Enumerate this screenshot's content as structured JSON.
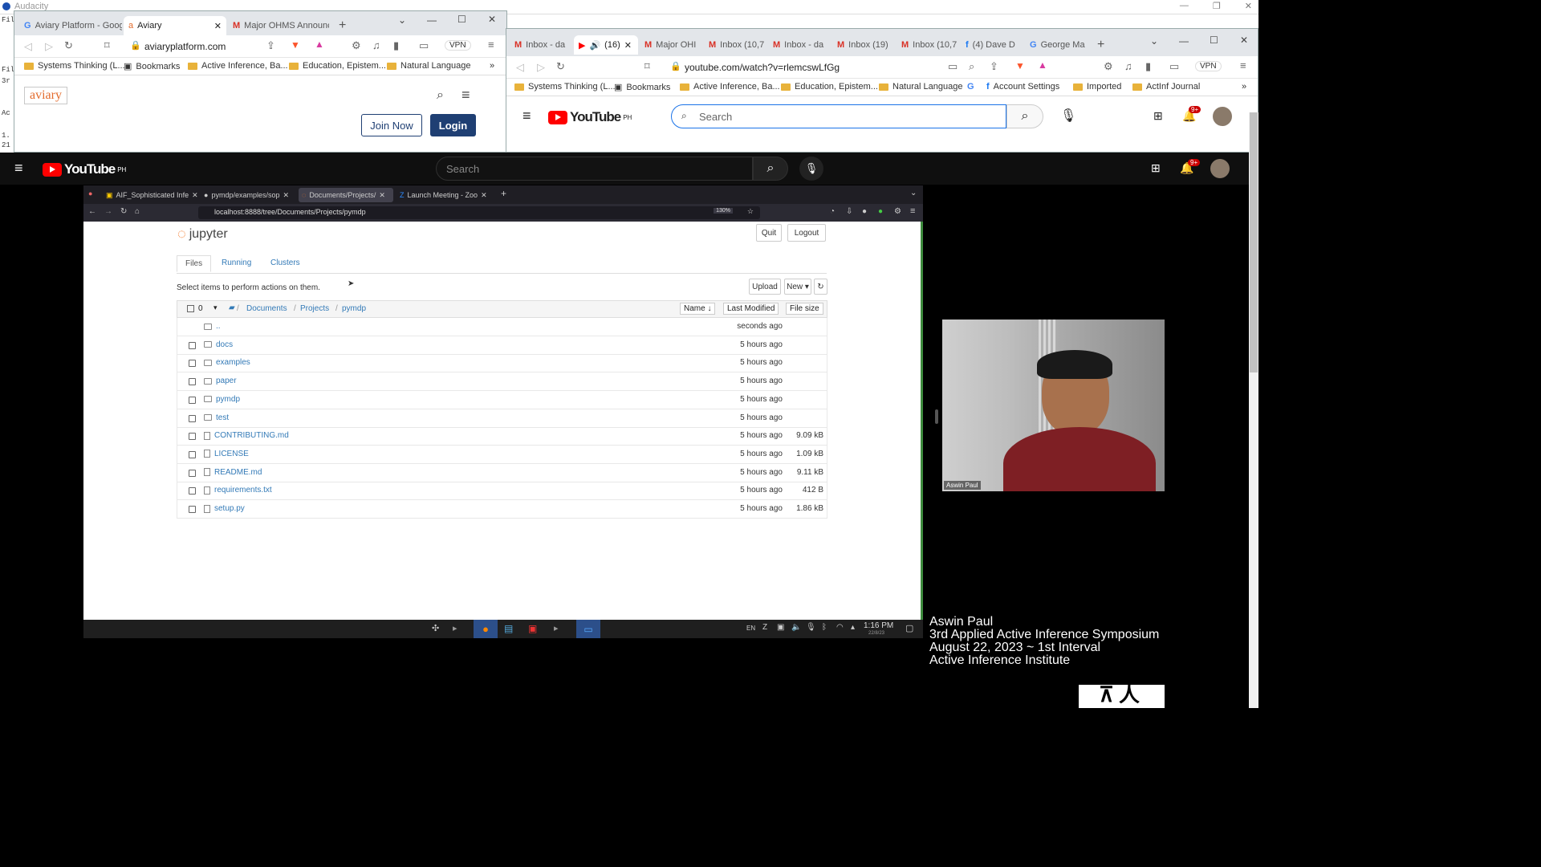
{
  "audacity": {
    "title": "Audacity"
  },
  "left_strip": [
    "Fil",
    "3r",
    "Ac",
    "Fil",
    "1.",
    "21"
  ],
  "aviary_window": {
    "tabs": [
      {
        "label": "Aviary Platform - Goog"
      },
      {
        "label": "Aviary",
        "active": true
      },
      {
        "label": "Major OHMS Announc"
      }
    ],
    "url": "aviaryplatform.com",
    "vpn": "VPN",
    "bookmarks": [
      "Systems Thinking (L...",
      "Bookmarks",
      "Active Inference, Ba...",
      "Education, Epistem...",
      "Natural Language"
    ],
    "logo": "aviary",
    "join_label": "Join Now",
    "login_label": "Login"
  },
  "youtube_window": {
    "tabs": [
      "Inbox - da",
      "(16)",
      "Major OHI",
      "Inbox (10,7",
      "Inbox - da",
      "Inbox (19)",
      "Inbox (10,7",
      "(4) Dave D",
      "George Ma"
    ],
    "url": "youtube.com/watch?v=rlemcswLfGg",
    "vpn": "VPN",
    "bookmarks": [
      "Systems Thinking (L...",
      "Bookmarks",
      "Active Inference, Ba...",
      "Education, Epistem...",
      "Natural Language",
      "Account Settings",
      "Imported",
      "ActInf Journal"
    ],
    "logo": "YouTube",
    "region": "PH",
    "search_placeholder": "Search",
    "notif": "9+"
  },
  "youtube_main": {
    "logo": "YouTube",
    "region": "PH",
    "search_placeholder": "Search",
    "notif": "9+"
  },
  "shared_screen": {
    "tabs": [
      "AIF_Sophisticated Infe",
      "pymdp/examples/sop",
      "Documents/Projects/",
      "Launch Meeting - Zoo"
    ],
    "url": "localhost:8888/tree/Documents/Projects/pymdp",
    "zoom": "130%",
    "jupyter": {
      "logo": "jupyter",
      "quit": "Quit",
      "logout": "Logout",
      "tabs": [
        "Files",
        "Running",
        "Clusters"
      ],
      "hint": "Select items to perform actions on them.",
      "upload": "Upload",
      "new": "New ▾",
      "selected_count": "0",
      "breadcrumb": [
        "Documents",
        "Projects",
        "pymdp"
      ],
      "col_name": "Name ↓",
      "col_modified": "Last Modified",
      "col_size": "File size",
      "rows": [
        {
          "name": "..",
          "modified": "seconds ago",
          "size": "",
          "type": "folder"
        },
        {
          "name": "docs",
          "modified": "5 hours ago",
          "size": "",
          "type": "folder"
        },
        {
          "name": "examples",
          "modified": "5 hours ago",
          "size": "",
          "type": "folder"
        },
        {
          "name": "paper",
          "modified": "5 hours ago",
          "size": "",
          "type": "folder"
        },
        {
          "name": "pymdp",
          "modified": "5 hours ago",
          "size": "",
          "type": "folder"
        },
        {
          "name": "test",
          "modified": "5 hours ago",
          "size": "",
          "type": "folder"
        },
        {
          "name": "CONTRIBUTING.md",
          "modified": "5 hours ago",
          "size": "9.09 kB",
          "type": "file"
        },
        {
          "name": "LICENSE",
          "modified": "5 hours ago",
          "size": "1.09 kB",
          "type": "file"
        },
        {
          "name": "README.md",
          "modified": "5 hours ago",
          "size": "9.11 kB",
          "type": "file"
        },
        {
          "name": "requirements.txt",
          "modified": "5 hours ago",
          "size": "412 B",
          "type": "file"
        },
        {
          "name": "setup.py",
          "modified": "5 hours ago",
          "size": "1.86 kB",
          "type": "file"
        }
      ]
    },
    "taskbar": {
      "lang": "EN",
      "time": "1:16 PM",
      "date": "22/8/23"
    }
  },
  "webcam": {
    "speaker": "Aswin Paul"
  },
  "caption": {
    "line1": "Aswin Paul",
    "line2": "3rd Applied Active Inference Symposium",
    "line3": "August 22, 2023 ~ 1st Interval",
    "line4": "Active Inference Institute"
  }
}
